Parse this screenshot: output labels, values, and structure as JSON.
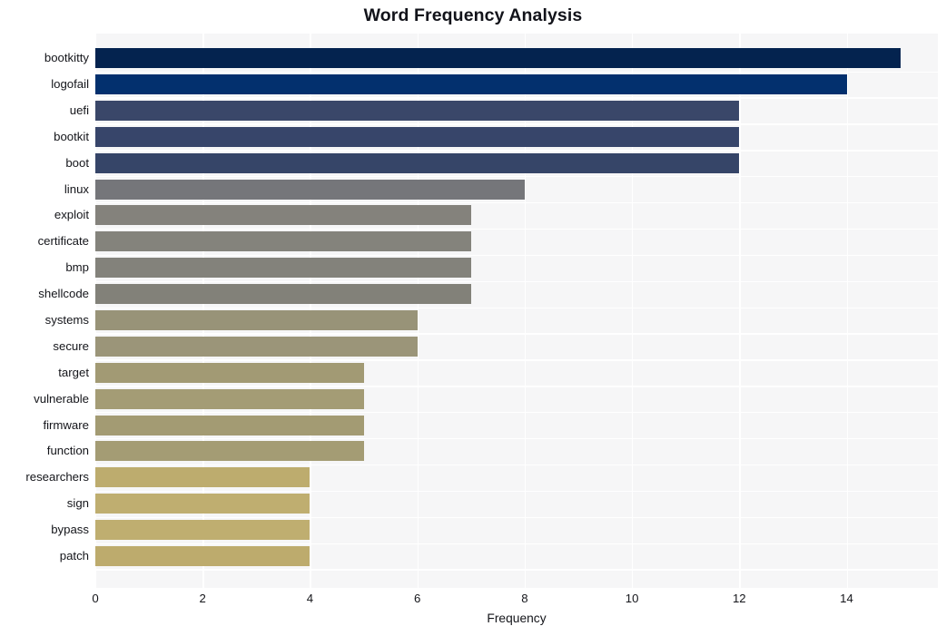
{
  "chart_data": {
    "type": "bar",
    "orientation": "horizontal",
    "title": "Word Frequency Analysis",
    "xlabel": "Frequency",
    "ylabel": "",
    "xlim": [
      0,
      15.7
    ],
    "xticks": [
      0,
      2,
      4,
      6,
      8,
      10,
      12,
      14
    ],
    "grid": true,
    "grid_color": "#ffffff",
    "plot_background": "#f6f6f7",
    "legend": null,
    "categories": [
      "bootkitty",
      "logofail",
      "uefi",
      "bootkit",
      "boot",
      "linux",
      "exploit",
      "certificate",
      "bmp",
      "shellcode",
      "systems",
      "secure",
      "target",
      "vulnerable",
      "firmware",
      "function",
      "researchers",
      "sign",
      "bypass",
      "patch"
    ],
    "values": [
      15,
      14,
      12,
      12,
      12,
      8,
      7,
      7,
      7,
      7,
      6,
      6,
      5,
      5,
      5,
      5,
      4,
      4,
      4,
      4
    ],
    "bar_colors": [
      "#04234f",
      "#03306e",
      "#3a4769",
      "#37456a",
      "#364568",
      "#75767a",
      "#84827c",
      "#84837c",
      "#83827b",
      "#828179",
      "#989378",
      "#9b9579",
      "#a29a74",
      "#a49c75",
      "#a39b73",
      "#a49c74",
      "#bdac6e",
      "#bfae70",
      "#bfae70",
      "#bdab6d"
    ]
  },
  "axis": {
    "title_color": "#12131a",
    "tick_color": "#14151a"
  }
}
